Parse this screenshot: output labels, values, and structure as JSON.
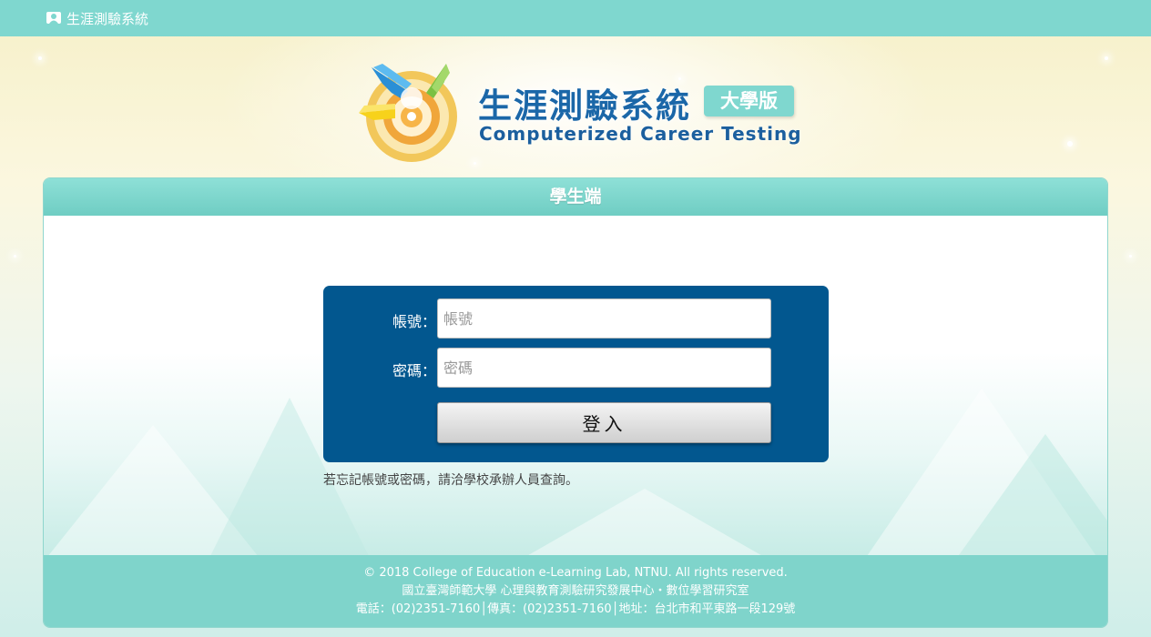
{
  "topbar": {
    "title": "生涯測驗系統",
    "icon": "user-card-icon"
  },
  "logo": {
    "title_cn": "生涯測驗系統",
    "badge": "大學版",
    "title_en": "Computerized Career Testing"
  },
  "panel": {
    "header": "學生端"
  },
  "login": {
    "account_label": "帳號：",
    "account_placeholder": "帳號",
    "password_label": "密碼：",
    "password_placeholder": "密碼",
    "submit_label": "登入"
  },
  "hint": "若忘記帳號或密碼，請洽學校承辦人員查詢。",
  "footer": {
    "copyright": "© 2018 College of Education e-Learning Lab, NTNU. All rights reserved.",
    "org": "國立臺灣師範大學 心理與教育測驗研究發展中心・數位學習研究室",
    "contact": "電話：(02)2351-7160│傳真：(02)2351-7160│地址：台北市和平東路一段129號"
  },
  "colors": {
    "topbar": "#7fd7cf",
    "login_box": "#02578f",
    "brand_blue": "#1b67a8"
  }
}
